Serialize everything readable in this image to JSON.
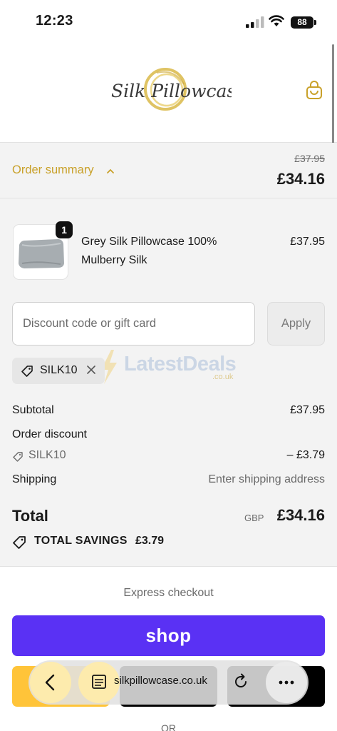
{
  "status_bar": {
    "time": "12:23",
    "battery": "88"
  },
  "header": {
    "logo_text": "Silk Pillowcase",
    "cart_icon": "shopping-bag-icon"
  },
  "summary": {
    "toggle_label": "Order summary",
    "original_price": "£37.95",
    "total_price": "£34.16"
  },
  "product": {
    "quantity": "1",
    "name": "Grey Silk Pillowcase 100% Mulberry Silk",
    "price": "£37.95"
  },
  "discount": {
    "placeholder": "Discount code or gift card",
    "apply_label": "Apply",
    "applied_code": "SILK10"
  },
  "watermark": {
    "text": "LatestDeals",
    "sub": ".co.uk"
  },
  "totals": {
    "subtotal_label": "Subtotal",
    "subtotal_value": "£37.95",
    "order_discount_label": "Order discount",
    "discount_code": "SILK10",
    "discount_value": "– £3.79",
    "shipping_label": "Shipping",
    "shipping_value": "Enter shipping address",
    "total_label": "Total",
    "currency": "GBP",
    "total_value": "£34.16",
    "savings_label": "TOTAL SAVINGS",
    "savings_value": "£3.79"
  },
  "express": {
    "label": "Express checkout",
    "shop_label": "shop",
    "or_label": "OR"
  },
  "browser": {
    "url": "silkpillowcase.co.uk"
  },
  "colors": {
    "accent_gold": "#c9a12a",
    "shop_purple": "#5a31f4",
    "paypal_yellow": "#ffc439"
  }
}
